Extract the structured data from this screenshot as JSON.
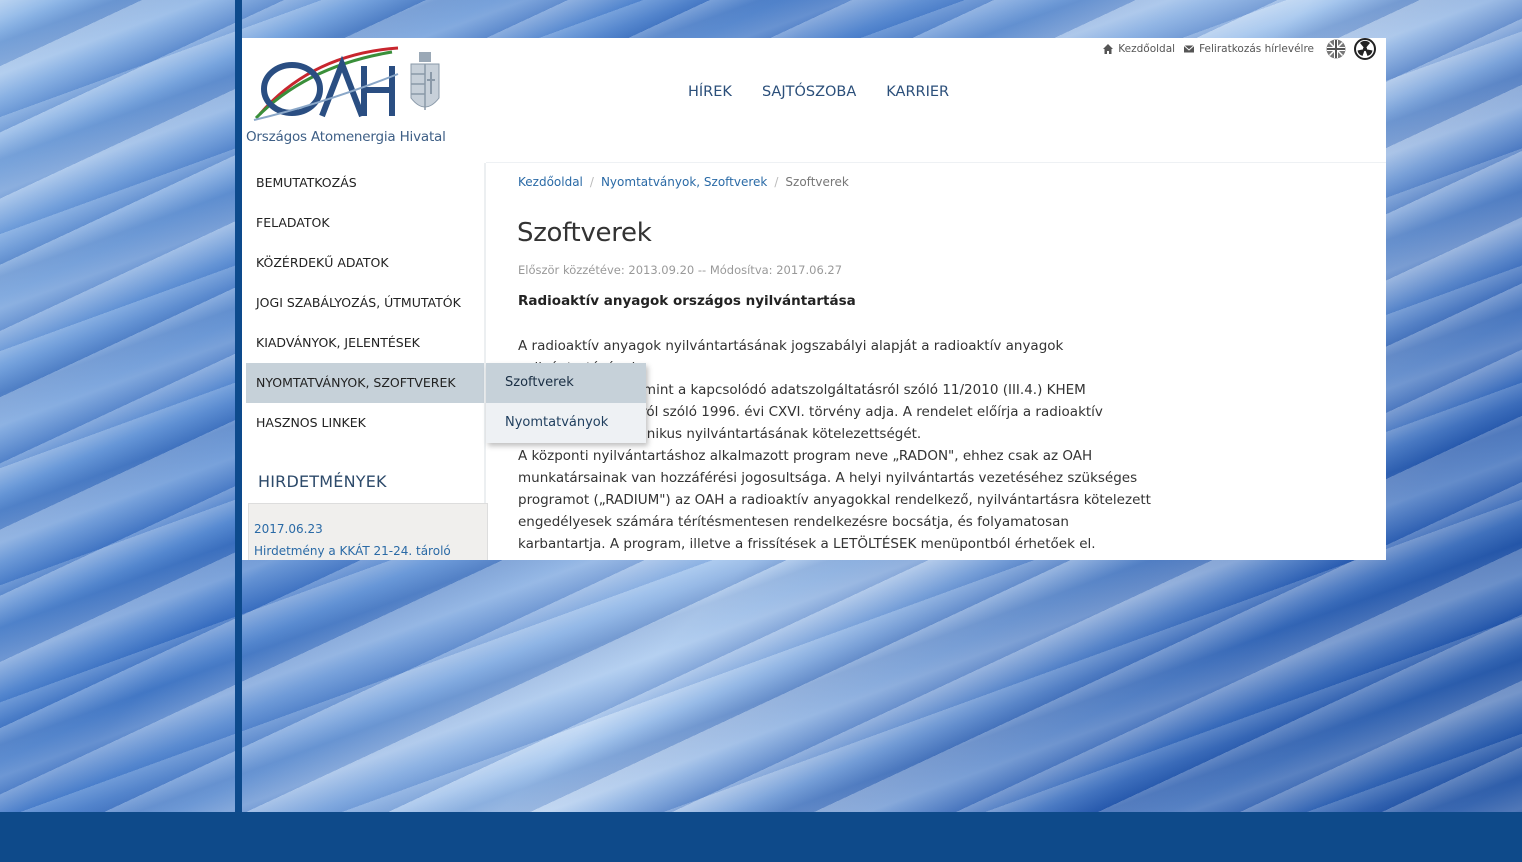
{
  "brand": {
    "logo_letters": "OAH",
    "name": "Országos Atomenergia Hivatal"
  },
  "topnav": [
    "HÍREK",
    "SAJTÓSZOBA",
    "KARRIER"
  ],
  "utility": {
    "home": "Kezdőoldal",
    "newsletter": "Feliratkozás hírlevélre"
  },
  "sidebar": {
    "items": [
      {
        "label": "BEMUTATKOZÁS"
      },
      {
        "label": "FELADATOK"
      },
      {
        "label": "KÖZÉRDEKŰ ADATOK"
      },
      {
        "label": "JOGI SZABÁLYOZÁS, ÚTMUTATÓK"
      },
      {
        "label": "KIADVÁNYOK, JELENTÉSEK"
      },
      {
        "label": "NYOMTATVÁNYOK, SZOFTVEREK"
      },
      {
        "label": "HASZNOS LINKEK"
      }
    ],
    "submenu": [
      "Szoftverek",
      "Nyomtatványok"
    ]
  },
  "notices": {
    "title": "HIRDETMÉNYEK",
    "date": "2017.06.23",
    "text": "Hirdetmény a KKÁT 21-24. tároló"
  },
  "breadcrumb": [
    "Kezdőoldal",
    "Nyomtatványok, Szoftverek",
    "Szoftverek"
  ],
  "article": {
    "title": "Szoftverek",
    "meta": "Először közzétéve: 2013.09.20 -- Módosítva: 2017.06.27",
    "lead": "Radioaktív anyagok országos nyilvántartása",
    "p1_visible": "A radioaktív anyagok nyilvántartásának jogszabályi alapját a radioaktív anyagok nyilvántartásának",
    "p1_line2": "endjéről, valamint a kapcsolódó adatszolgáltatásról szóló 11/2010 (III.4.) KHEM",
    "p1_line3": "energiáról szóló 1996. évi CXVI. törvény adja. A rendelet előírja a radioaktív",
    "p1_line4": "zponti elektronikus nyilvántartásának kötelezettségét.",
    "p2": "A központi nyilvántartáshoz alkalmazott program neve „RADON\", ehhez csak az OAH munkatársainak van hozzáférési jogosultsága. A helyi nyilvántartás vezetéséhez szükséges programot („RADIUM\") az OAH a radioaktív anyagokkal rendelkező, nyilvántartásra kötelezett engedélyesek számára térítésmentesen rendelkezésre bocsátja, és folyamatosan karbantartja. A program, illetve a frissítések a LETÖLTÉSEK menüpontból érhetőek el."
  },
  "colors": {
    "brand_blue": "#2a6aa6",
    "active_bg": "#c6d1d9",
    "footer": "#0e4a8a"
  }
}
